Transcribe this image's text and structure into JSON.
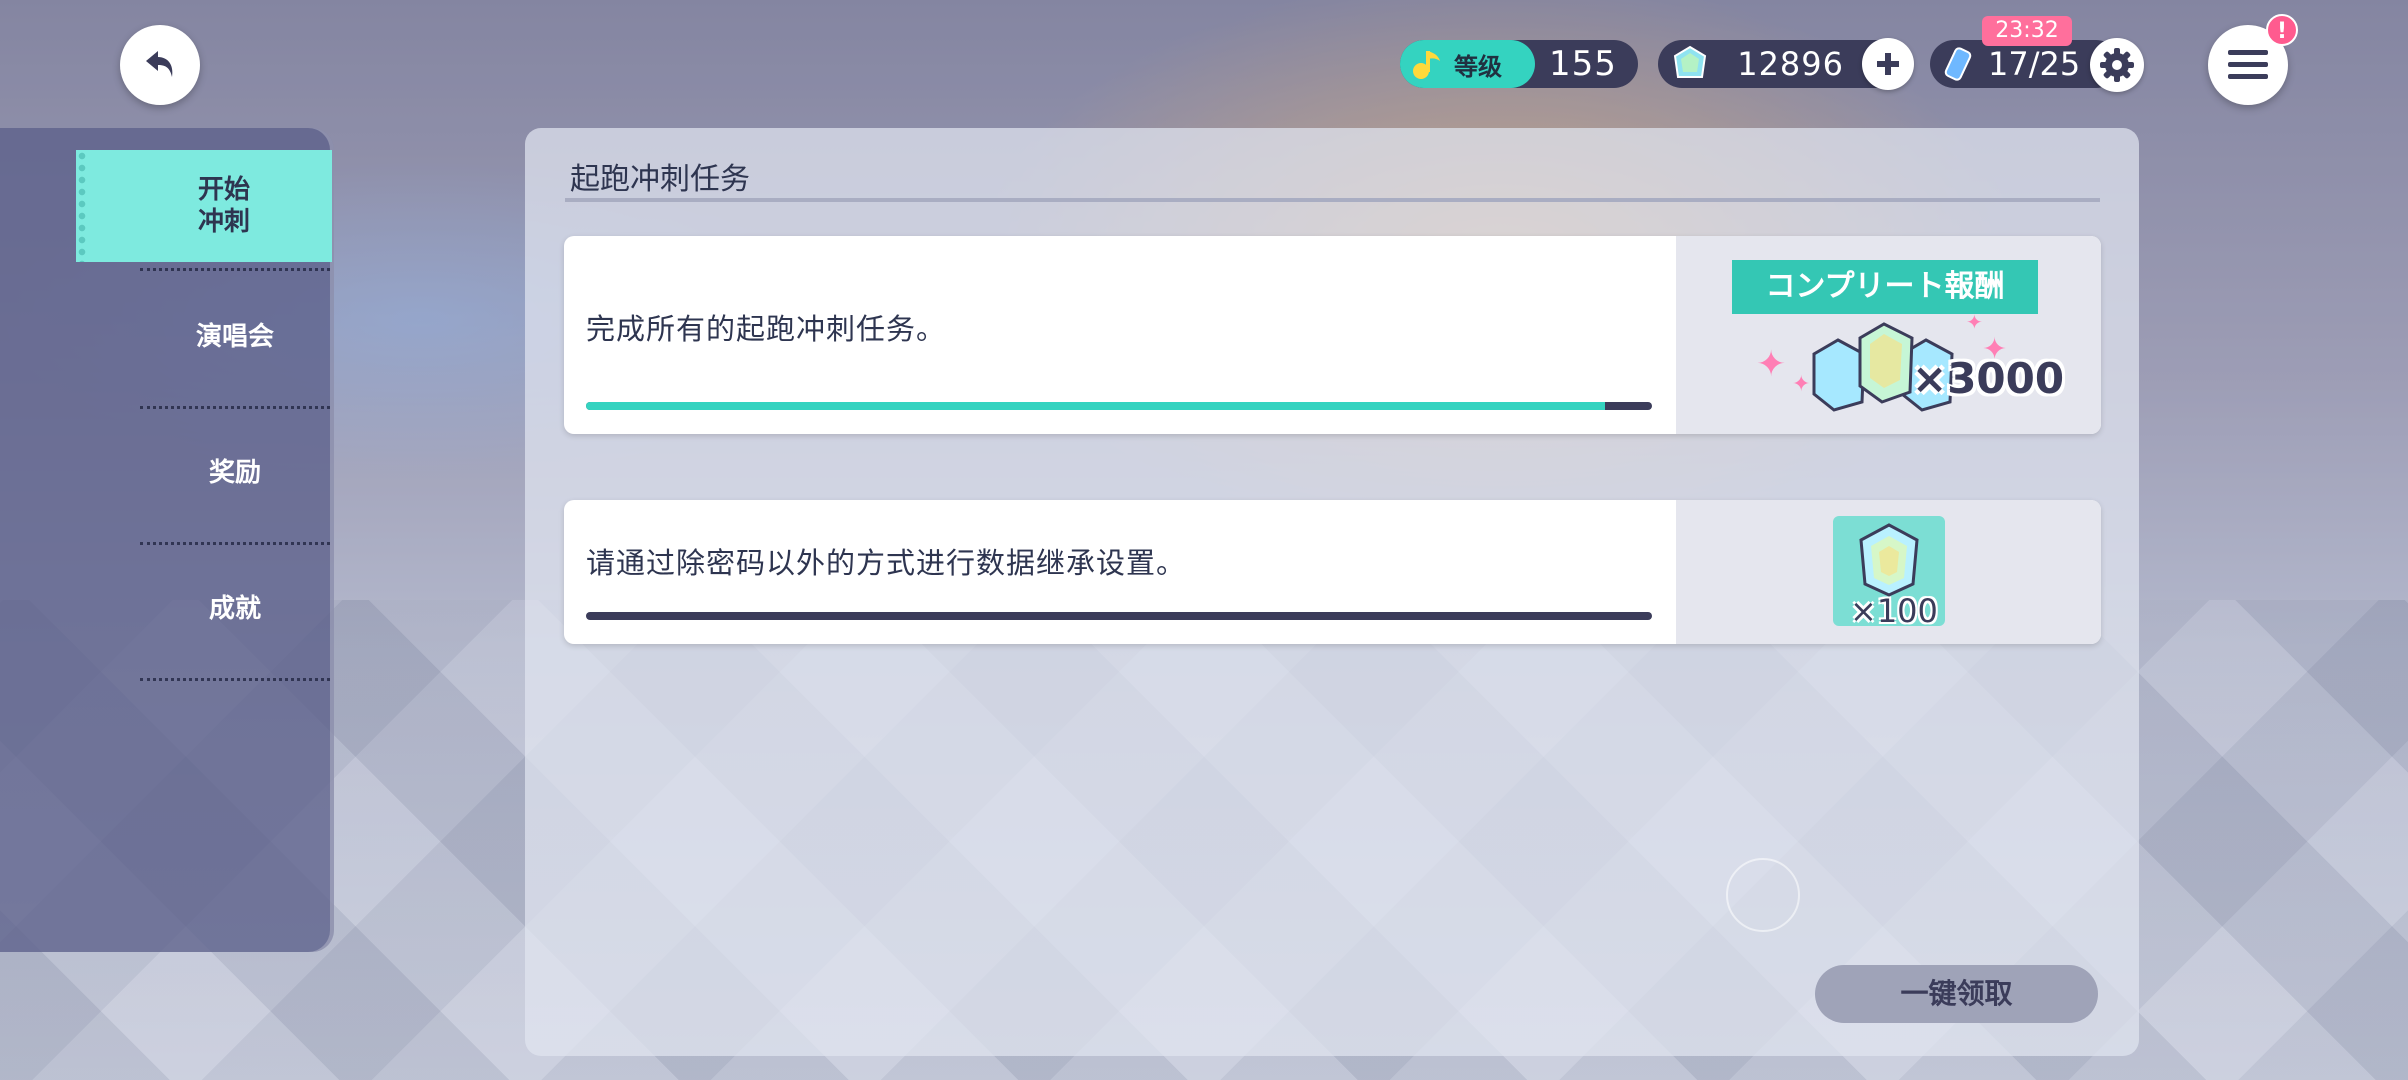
{
  "header": {
    "rank_label": "等级",
    "rank_value": "155",
    "gems_value": "12896",
    "stamina_value": "17/25",
    "stamina_time": "23:32",
    "menu_alert": "!"
  },
  "sidebar": {
    "items": [
      {
        "label": "开始\n冲刺",
        "active": true
      },
      {
        "label": "演唱会",
        "active": false
      },
      {
        "label": "奖励",
        "active": false
      },
      {
        "label": "成就",
        "active": false
      }
    ]
  },
  "main": {
    "title": "起跑冲刺任务",
    "missions": [
      {
        "description": "完成所有的起跑冲刺任务。",
        "progress": 0.956,
        "reward_banner": "コンプリート報酬",
        "reward_qty": "×3000"
      },
      {
        "description": "请通过除密码以外的方式进行数据继承设置。",
        "progress": 0,
        "reward_qty": "×100"
      }
    ],
    "claim_all_label": "一键领取"
  },
  "colors": {
    "accent": "#34d3c0",
    "dark": "#3b3c5a",
    "pink": "#ff6f9c"
  }
}
